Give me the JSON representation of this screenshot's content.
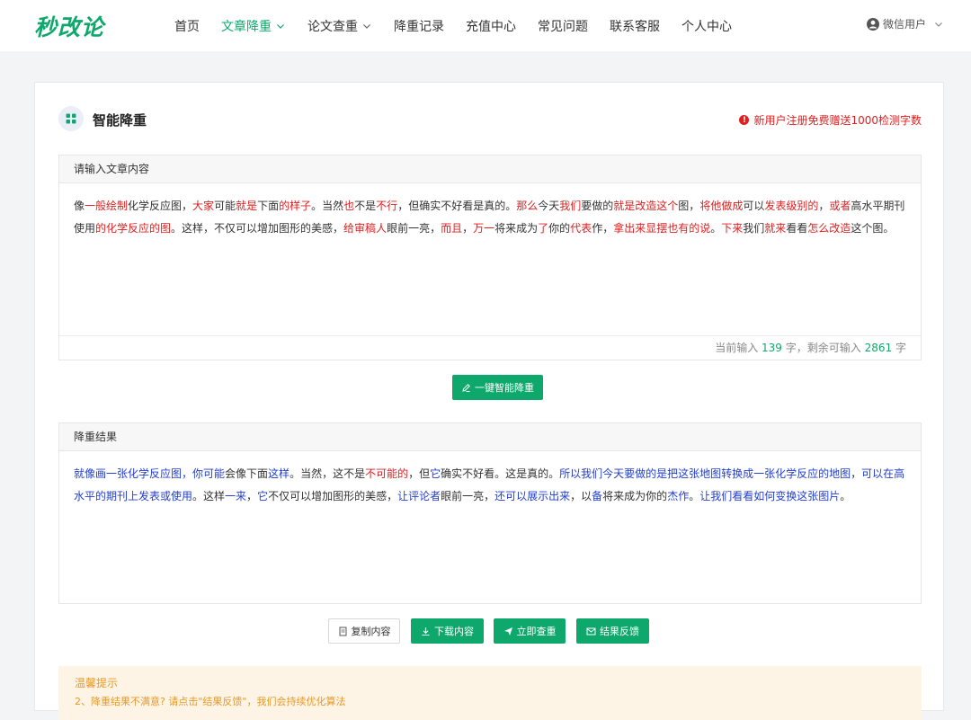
{
  "header": {
    "logo": "秒改论",
    "nav": [
      {
        "label": "首页",
        "active": false,
        "dropdown": false
      },
      {
        "label": "文章降重",
        "active": true,
        "dropdown": true
      },
      {
        "label": "论文查重",
        "active": false,
        "dropdown": true
      },
      {
        "label": "降重记录",
        "active": false,
        "dropdown": false
      },
      {
        "label": "充值中心",
        "active": false,
        "dropdown": false
      },
      {
        "label": "常见问题",
        "active": false,
        "dropdown": false
      },
      {
        "label": "联系客服",
        "active": false,
        "dropdown": false
      },
      {
        "label": "个人中心",
        "active": false,
        "dropdown": false
      }
    ],
    "user": "微信用户"
  },
  "card": {
    "title": "智能降重",
    "promo": "新用户注册免费赠送1000检测字数"
  },
  "input_panel": {
    "label": "请输入文章内容",
    "segments": [
      {
        "t": "像",
        "c": ""
      },
      {
        "t": "一般绘制",
        "c": "red"
      },
      {
        "t": "化学反应图，",
        "c": ""
      },
      {
        "t": "大家",
        "c": "red"
      },
      {
        "t": "可能",
        "c": ""
      },
      {
        "t": "就是",
        "c": "red"
      },
      {
        "t": "下面",
        "c": ""
      },
      {
        "t": "的样子",
        "c": "red"
      },
      {
        "t": "。当然",
        "c": ""
      },
      {
        "t": "也",
        "c": "red"
      },
      {
        "t": "不是",
        "c": ""
      },
      {
        "t": "不行",
        "c": "red"
      },
      {
        "t": "，但确实不好看是真的。",
        "c": ""
      },
      {
        "t": "那么",
        "c": "red"
      },
      {
        "t": "今天",
        "c": ""
      },
      {
        "t": "我们",
        "c": "red"
      },
      {
        "t": "要做的",
        "c": ""
      },
      {
        "t": "就是",
        "c": "red"
      },
      {
        "t": "改造这个",
        "c": "red"
      },
      {
        "t": "图，",
        "c": ""
      },
      {
        "t": "将他做成",
        "c": "red"
      },
      {
        "t": "可以",
        "c": ""
      },
      {
        "t": "发表级别的",
        "c": "red"
      },
      {
        "t": "，",
        "c": ""
      },
      {
        "t": "或者",
        "c": "red"
      },
      {
        "t": "高水平期刊使用",
        "c": ""
      },
      {
        "t": "的化学反应的图",
        "c": "red"
      },
      {
        "t": "。这样，不仅可以增加图形的美感，",
        "c": ""
      },
      {
        "t": "给审稿人",
        "c": "red"
      },
      {
        "t": "眼前一亮，",
        "c": ""
      },
      {
        "t": "而且",
        "c": "red"
      },
      {
        "t": "，",
        "c": ""
      },
      {
        "t": "万一",
        "c": "red"
      },
      {
        "t": "将来成为",
        "c": ""
      },
      {
        "t": "了",
        "c": "red"
      },
      {
        "t": "你的",
        "c": ""
      },
      {
        "t": "代表",
        "c": "red"
      },
      {
        "t": "作，",
        "c": ""
      },
      {
        "t": "拿出来显摆也有的说",
        "c": "red"
      },
      {
        "t": "。",
        "c": ""
      },
      {
        "t": "下来",
        "c": "red"
      },
      {
        "t": "我们",
        "c": ""
      },
      {
        "t": "就来",
        "c": "red"
      },
      {
        "t": "看看",
        "c": ""
      },
      {
        "t": "怎么改造",
        "c": "red"
      },
      {
        "t": "这个图。",
        "c": ""
      }
    ],
    "count_prefix": "当前输入",
    "count_value": "139",
    "count_mid": "字，剩余可输入",
    "remain_value": "2861",
    "count_suffix": "字"
  },
  "action_button": "一键智能降重",
  "result_panel": {
    "label": "降重结果",
    "segments": [
      {
        "t": "就像画一张化学反应图，",
        "c": "blue"
      },
      {
        "t": "你可能",
        "c": "blue"
      },
      {
        "t": "会像下面",
        "c": ""
      },
      {
        "t": "这样",
        "c": "blue"
      },
      {
        "t": "。当然，这不是",
        "c": ""
      },
      {
        "t": "不可能的",
        "c": "red"
      },
      {
        "t": "，但",
        "c": ""
      },
      {
        "t": "它",
        "c": "blue"
      },
      {
        "t": "确实不好看。这是真的。",
        "c": ""
      },
      {
        "t": "所以我们今天要做的是把这张地图转换成一张化学反应的地图",
        "c": "blue"
      },
      {
        "t": "，",
        "c": ""
      },
      {
        "t": "可以在高水平的期刊上发表或使用",
        "c": "blue"
      },
      {
        "t": "。这样",
        "c": ""
      },
      {
        "t": "一来",
        "c": "blue"
      },
      {
        "t": "，",
        "c": ""
      },
      {
        "t": "它",
        "c": "blue"
      },
      {
        "t": "不仅可以增加图形的美感，",
        "c": ""
      },
      {
        "t": "让评论者",
        "c": "blue"
      },
      {
        "t": "眼前一亮，",
        "c": ""
      },
      {
        "t": "还可以展示出来",
        "c": "blue"
      },
      {
        "t": "，以",
        "c": ""
      },
      {
        "t": "备",
        "c": "blue"
      },
      {
        "t": "将来成为你的",
        "c": ""
      },
      {
        "t": "杰作",
        "c": "blue"
      },
      {
        "t": "。",
        "c": ""
      },
      {
        "t": "让我们看看如何变换这张图片",
        "c": "blue"
      },
      {
        "t": "。",
        "c": ""
      }
    ]
  },
  "buttons": {
    "copy": "复制内容",
    "download": "下载内容",
    "check": "立即查重",
    "feedback": "结果反馈"
  },
  "tips": {
    "title": "温馨提示",
    "line1": "2、降重结果不满意? 请点击\"结果反馈\"，我们会持续优化算法"
  },
  "colors": {
    "brand": "#0ea86c",
    "highlight_red": "#e02020",
    "highlight_blue": "#2440d0"
  }
}
